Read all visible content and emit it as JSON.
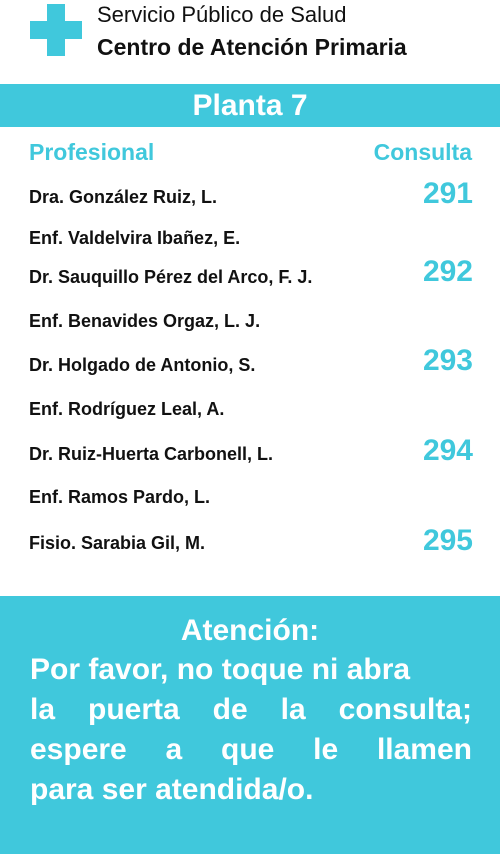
{
  "header": {
    "organization": "Servicio Público de Salud",
    "center_name": "Centro de Atención Primaria",
    "logo_icon": "medical-cross-icon"
  },
  "floor": {
    "label": "Planta 7"
  },
  "table": {
    "col_professional": "Profesional",
    "col_room": "Consulta",
    "rows": [
      {
        "name": "Dra. González Ruiz, L.",
        "room": "291"
      },
      {
        "name": "Enf. Valdelvira Ibañez, E.",
        "room": ""
      },
      {
        "name": "Dr. Sauquillo Pérez del Arco, F. J.",
        "room": "292"
      },
      {
        "name": "Enf. Benavides Orgaz, L. J.",
        "room": ""
      },
      {
        "name": "Dr. Holgado de Antonio, S.",
        "room": "293"
      },
      {
        "name": "Enf. Rodríguez Leal, A.",
        "room": ""
      },
      {
        "name": "Dr. Ruiz-Huerta Carbonell, L.",
        "room": "294"
      },
      {
        "name": "Enf. Ramos Pardo, L.",
        "room": ""
      },
      {
        "name": "Fisio. Sarabia Gil, M.",
        "room": "295"
      }
    ]
  },
  "notice": {
    "title": "Atención:",
    "lines": [
      "Por favor, no toque ni abra",
      "la puerta de la consulta;",
      "espere a que le llamen",
      "para ser atendida/o."
    ]
  },
  "colors": {
    "accent": "#40c8dc",
    "text": "#111111",
    "background": "#ffffff"
  }
}
